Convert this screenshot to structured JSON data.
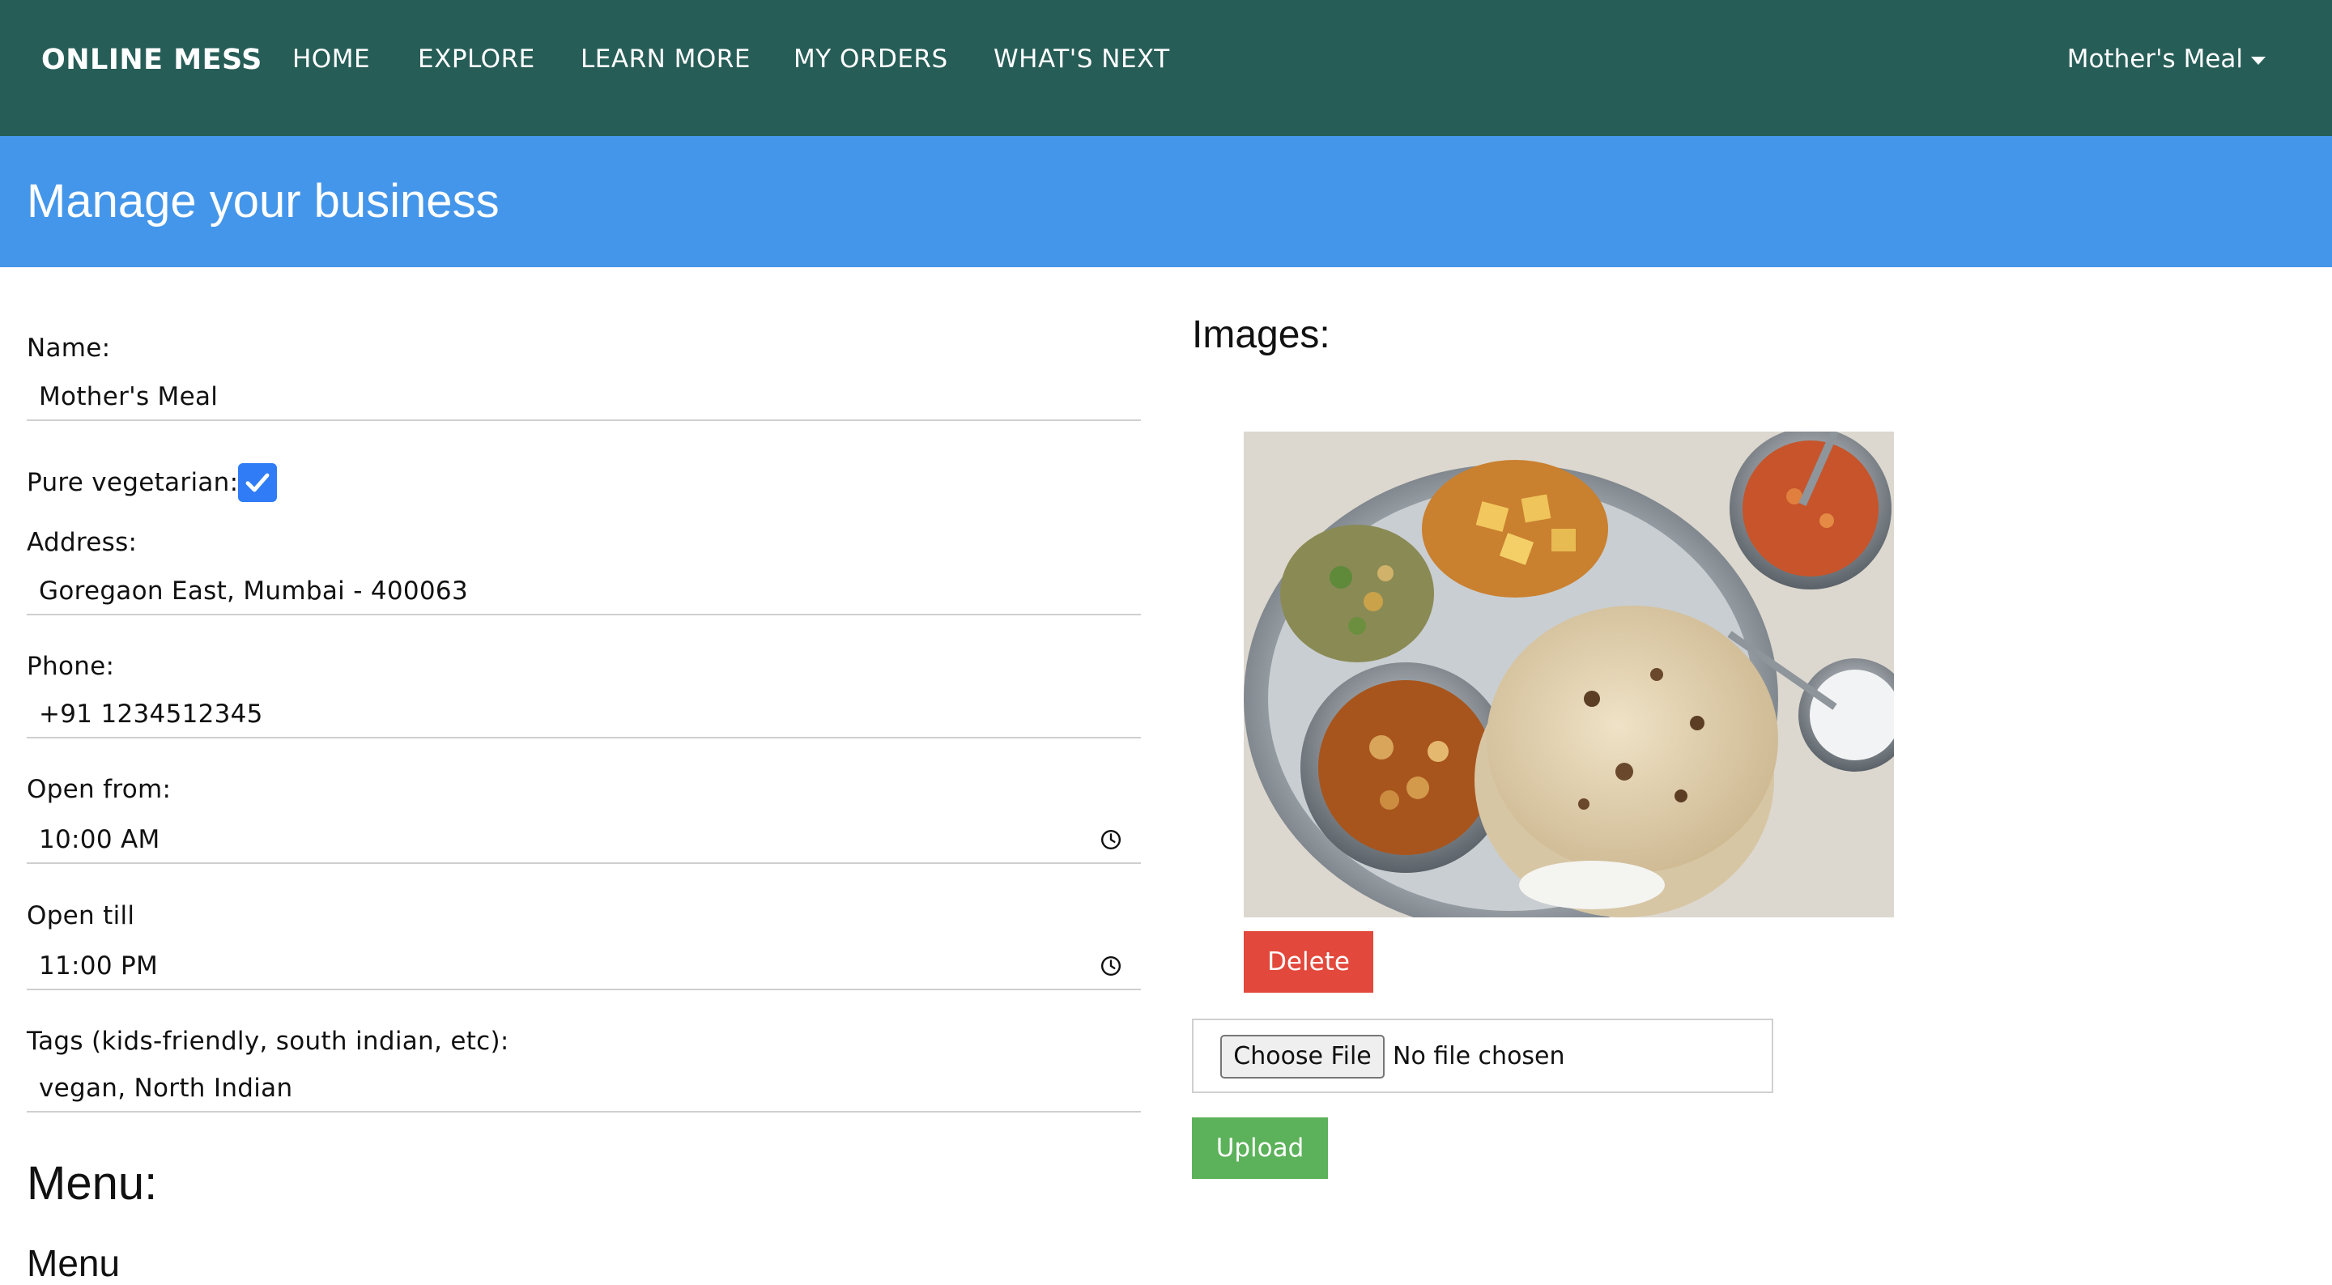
{
  "navbar": {
    "brand": "ONLINE MESS",
    "links": [
      "HOME",
      "EXPLORE",
      "LEARN MORE",
      "MY ORDERS",
      "WHAT'S NEXT"
    ],
    "user": "Mother's Meal",
    "background": "#275d57"
  },
  "banner": {
    "title": "Manage your business",
    "background": "#4496ea"
  },
  "form": {
    "name_label": "Name:",
    "name_value": "Mother's Meal",
    "veg_label": "Pure vegetarian:",
    "veg_checked": true,
    "address_label": "Address:",
    "address_value": "Goregaon East, Mumbai - 400063",
    "phone_label": "Phone:",
    "phone_value": "+91 1234512345",
    "open_from_label": "Open from:",
    "open_from_value": "10:00 AM",
    "open_till_label": "Open till",
    "open_till_value": "11:00 PM",
    "tags_label": "Tags (kids-friendly, south indian, etc):",
    "tags_value": "vegan, North Indian"
  },
  "menu": {
    "title": "Menu:",
    "subtitle": "Menu"
  },
  "images": {
    "title": "Images:",
    "delete_label": "Delete",
    "choose_file_label": "Choose File",
    "file_status": "No file chosen",
    "upload_label": "Upload",
    "delete_color": "#e2483b",
    "upload_color": "#5cb25a"
  },
  "icons": {
    "time": "clock-icon",
    "dropdown": "caret-down-icon",
    "checkbox": "checkmark-icon"
  }
}
